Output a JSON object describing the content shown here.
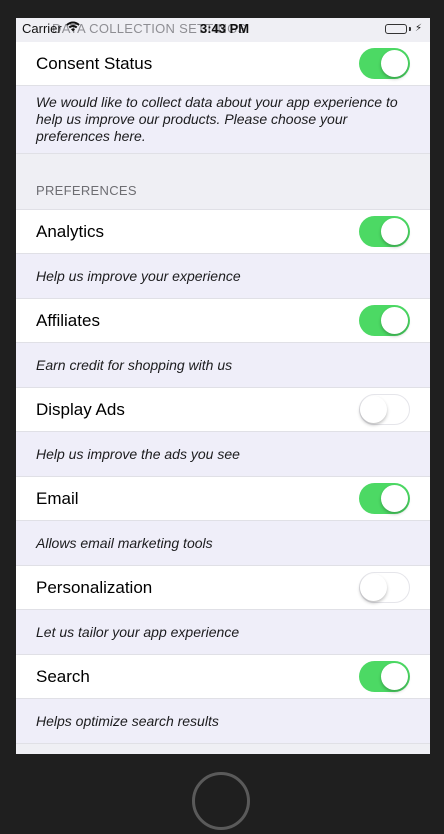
{
  "status_bar": {
    "carrier": "Carrier",
    "nav_title": "DATA COLLECTION SETTINGS",
    "time": "3:43 PM"
  },
  "consent": {
    "label": "Consent Status",
    "enabled": true,
    "description": "We would like to collect data about your app experience to help us improve our products. Please choose your preferences here."
  },
  "preferences_header": "PREFERENCES",
  "preferences": [
    {
      "label": "Analytics",
      "enabled": true,
      "description": "Help us improve your experience"
    },
    {
      "label": "Affiliates",
      "enabled": true,
      "description": "Earn credit for shopping with us"
    },
    {
      "label": "Display Ads",
      "enabled": false,
      "description": "Help us improve the ads you see"
    },
    {
      "label": "Email",
      "enabled": true,
      "description": "Allows email marketing tools"
    },
    {
      "label": "Personalization",
      "enabled": false,
      "description": "Let us tailor your app experience"
    },
    {
      "label": "Search",
      "enabled": true,
      "description": "Helps optimize search results"
    }
  ],
  "colors": {
    "toggle_on": "#4cd964",
    "description_bg": "#efeef9",
    "grouped_bg": "#efeff4"
  }
}
